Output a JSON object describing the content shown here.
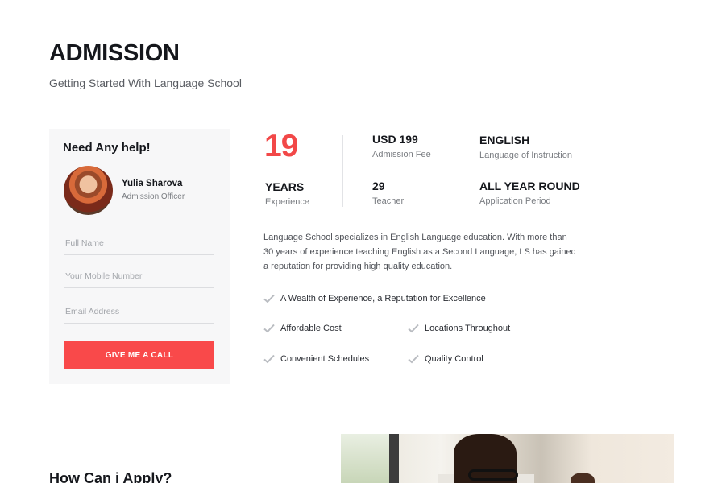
{
  "header": {
    "title": "ADMISSION",
    "subtitle": "Getting Started With Language School"
  },
  "help_card": {
    "title": "Need Any help!",
    "agent_name": "Yulia Sharova",
    "agent_role": "Admission Officer",
    "name_placeholder": "Full Name",
    "mobile_placeholder": "Your Mobile Number",
    "email_placeholder": "Email Address",
    "button_label": "GIVE ME A CALL"
  },
  "highlight": {
    "number": "19",
    "label": "YEARS",
    "sub": "Experience"
  },
  "stats": {
    "fee": {
      "value": "USD 199",
      "label": "Admission Fee"
    },
    "language": {
      "value": "ENGLISH",
      "label": "Language of Instruction"
    },
    "teachers": {
      "value": "29",
      "label": "Teacher"
    },
    "period": {
      "value": "ALL YEAR ROUND",
      "label": "Application Period"
    }
  },
  "description": "Language School specializes in English Language education. With more than 30 years of experience teaching English as a Second Language, LS has gained a reputation for providing high quality education.",
  "features": [
    "A Wealth of Experience, a Reputation for Excellence",
    "Affordable Cost",
    "Locations Throughout",
    "Convenient Schedules",
    "Quality Control"
  ],
  "apply": {
    "title": "How Can i Apply?"
  },
  "colors": {
    "accent": "#f9494a",
    "highlight_number": "#f24848",
    "card_bg": "#f7f7f8",
    "check": "#b9bcc1"
  },
  "icons": {
    "feature_icon": "check-icon"
  }
}
